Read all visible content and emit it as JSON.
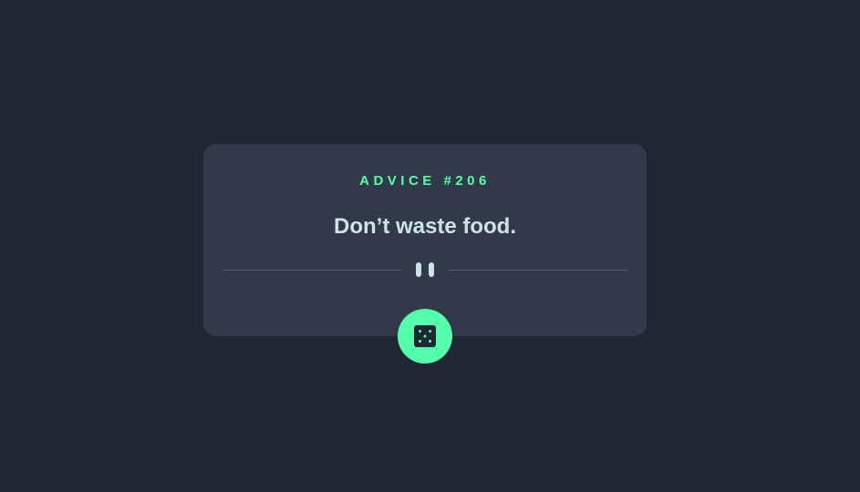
{
  "card": {
    "advice_id": "ADVICE #206",
    "advice_text": "Don’t waste food."
  },
  "icons": {
    "divider_icon": "pause-icon",
    "button_icon": "dice-icon"
  },
  "colors": {
    "background": "#202632",
    "card": "#323A49",
    "accent": "#53FFAA",
    "text": "#CEE3E9",
    "divider": "#4F5D74"
  }
}
